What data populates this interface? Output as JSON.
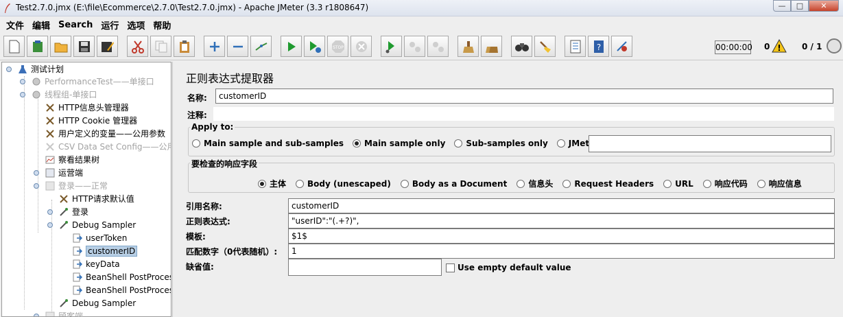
{
  "window": {
    "title": "Test2.7.0.jmx (E:\\file\\Ecommerce\\2.7.0\\Test2.7.0.jmx) - Apache JMeter (3.3 r1808647)",
    "minimize": "—",
    "maximize": "□",
    "close": "✕"
  },
  "menu": [
    "文件",
    "编辑",
    "Search",
    "运行",
    "选项",
    "帮助"
  ],
  "toolbar": {
    "timer": "00:00:00",
    "error_count": "0",
    "threads": "0 / 1",
    "icons": [
      "new-icon",
      "templates-icon",
      "open-icon",
      "save-icon",
      "save-as-icon",
      "cut-icon",
      "copy-icon",
      "paste-icon",
      "expand-icon",
      "collapse-icon",
      "toggle-icon",
      "start-icon",
      "start-no-pause-icon",
      "stop-icon",
      "shutdown-icon",
      "remote-start-icon",
      "remote-stop-icon",
      "remote-shutdown-icon",
      "clear-icon",
      "clear-all-icon",
      "search-icon",
      "reset-search-icon",
      "function-helper-icon",
      "help-icon",
      "log-viewer-icon"
    ]
  },
  "tree": {
    "nodes": [
      {
        "label": "测试计划"
      },
      {
        "label": "PerformanceTest——单接口"
      },
      {
        "label": "线程组-单接口"
      },
      {
        "label": "HTTP信息头管理器"
      },
      {
        "label": "HTTP Cookie 管理器"
      },
      {
        "label": "用户定义的变量——公用参数"
      },
      {
        "label": "CSV Data Set Config——公用"
      },
      {
        "label": "察看结果树"
      },
      {
        "label": "运营端"
      },
      {
        "label": "登录——正常"
      },
      {
        "label": "HTTP请求默认值"
      },
      {
        "label": "登录"
      },
      {
        "label": "Debug Sampler"
      },
      {
        "label": "userToken"
      },
      {
        "label": "customerID"
      },
      {
        "label": "keyData"
      },
      {
        "label": "BeanShell PostProces"
      },
      {
        "label": "BeanShell PostProces"
      },
      {
        "label": "Debug Sampler"
      },
      {
        "label": "顾客端"
      }
    ]
  },
  "panel": {
    "title": "正则表达式提取器",
    "name_label": "名称:",
    "name_value": "customerID",
    "comment_label": "注释:",
    "comment_value": "",
    "apply_to": {
      "title": "Apply to:",
      "options": [
        "Main sample and sub-samples",
        "Main sample only",
        "Sub-samples only",
        "JMeter Variable"
      ],
      "selected": "Main sample only",
      "variable_value": ""
    },
    "field_to_check": {
      "title": "要检查的响应字段",
      "options": [
        "主体",
        "Body (unescaped)",
        "Body as a Document",
        "信息头",
        "Request Headers",
        "URL",
        "响应代码",
        "响应信息"
      ],
      "selected": "主体"
    },
    "ref_name_label": "引用名称:",
    "ref_name_value": "customerID",
    "regex_label": "正则表达式:",
    "regex_value": "\"userID\":\"(.+?)\",",
    "template_label": "模板:",
    "template_value": "$1$",
    "match_no_label": "匹配数字（0代表随机）:",
    "match_no_value": "1",
    "default_label": "缺省值:",
    "default_value": "",
    "use_empty_label": "Use empty default value"
  }
}
